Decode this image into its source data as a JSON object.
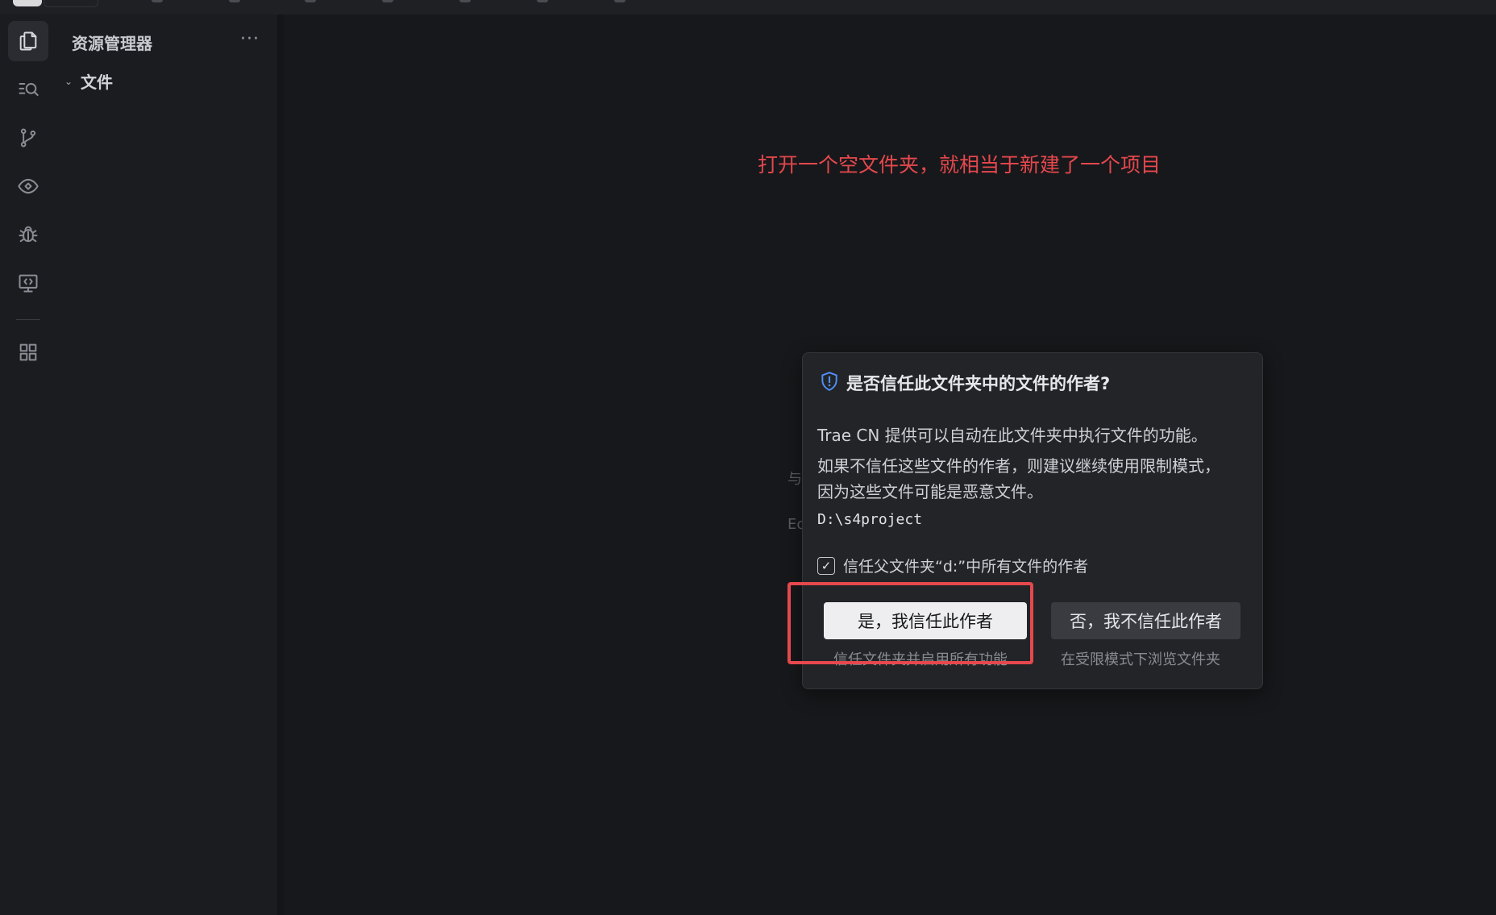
{
  "sidebar": {
    "title": "资源管理器",
    "more": "···",
    "folder_label": "文件"
  },
  "editor": {
    "annotation": "打开一个空文件夹，就相当于新建了一个项目",
    "faded_1": "与",
    "faded_2": "Ec"
  },
  "dialog": {
    "title": "是否信任此文件夹中的文件的作者?",
    "line1": "Trae CN 提供可以自动在此文件夹中执行文件的功能。",
    "line2": "如果不信任这些文件的作者，则建议继续使用限制模式，",
    "line3": "因为这些文件可能是恶意文件。",
    "path": "D:\\s4project",
    "checkbox_label": "信任父文件夹“d:”中所有文件的作者",
    "checkbox_checked": true,
    "trust_button": "是，我信任此作者",
    "trust_sub": "信任文件夹并启用所有功能",
    "no_trust_button": "否，我不信任此作者",
    "no_trust_sub": "在受限模式下浏览文件夹"
  },
  "colors": {
    "annotation": "#e5484d",
    "highlight": "#e5484d",
    "shield": "#4f8ff7"
  },
  "icons": [
    "explorer-icon",
    "search-icon",
    "source-control-icon",
    "ai-eye-icon",
    "debug-icon",
    "remote-icon",
    "extensions-icon",
    "shield-icon",
    "check-icon",
    "chevron-down-icon"
  ]
}
